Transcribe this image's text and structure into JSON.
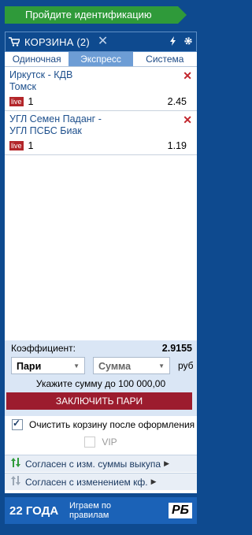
{
  "verify_button": "Пройдите идентификацию",
  "cart": {
    "title": "КОРЗИНА (2)",
    "tabs": [
      "Одиночная",
      "Экспресс",
      "Система"
    ],
    "active_tab": "Экспресс",
    "bets": [
      {
        "event": "Иркутск - КДВ Томск",
        "live": "live",
        "outcome": "1",
        "odd": "2.45"
      },
      {
        "event": "УГЛ Семен Паданг - УГЛ ПСБС Биак",
        "live": "live",
        "outcome": "1",
        "odd": "1.19"
      }
    ]
  },
  "summary": {
    "coef_label": "Коэффициент:",
    "coef_value": "2.9155",
    "bet_type": "Пари",
    "amount_placeholder": "Сумма",
    "currency": "руб",
    "hint": "Укажите сумму до 100 000,00",
    "place_button": "ЗАКЛЮЧИТЬ ПАРИ"
  },
  "options": {
    "clear_cart": "Очистить корзину после оформления",
    "vip": "VIP",
    "agree_cashout": "Согласен с изм. суммы выкупа",
    "agree_odds": "Согласен с изменением кф."
  },
  "banner": {
    "years": "22 ГОДА",
    "slogan": "Играем по правилам",
    "logo": "РБ"
  },
  "colors": {
    "brand_blue": "#0e4a8f",
    "green": "#2f9a3a",
    "place_red": "#9c1c2e",
    "live_red": "#b3262a"
  }
}
